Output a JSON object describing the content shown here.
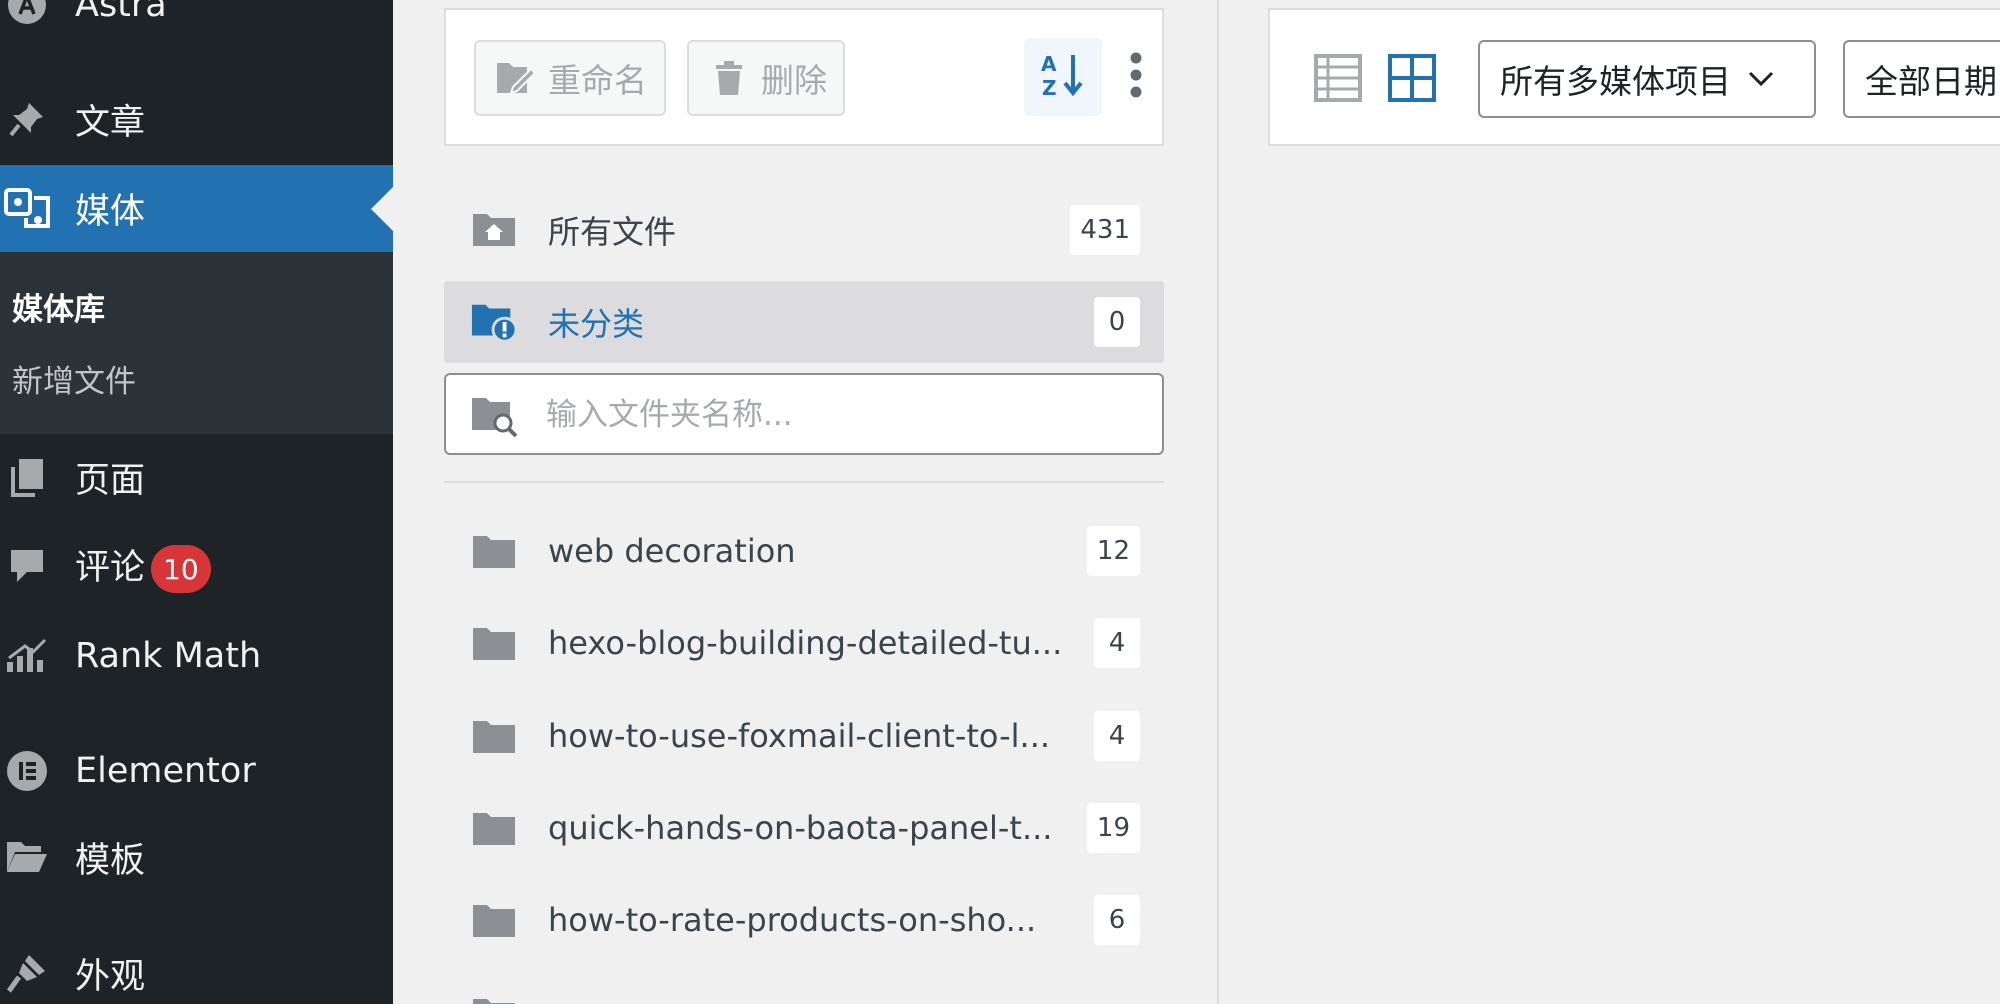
{
  "sidebar": {
    "items": [
      {
        "key": "astra",
        "label": "Astra",
        "icon": "astra-logo-icon"
      },
      {
        "key": "posts",
        "label": "文章",
        "icon": "pin-icon"
      },
      {
        "key": "media",
        "label": "媒体",
        "icon": "media-icon",
        "active": true
      },
      {
        "key": "pages",
        "label": "页面",
        "icon": "pages-icon"
      },
      {
        "key": "comments",
        "label": "评论",
        "icon": "comment-icon",
        "badge": "10"
      },
      {
        "key": "rankmath",
        "label": "Rank Math",
        "icon": "rank-math-icon"
      },
      {
        "key": "elementor",
        "label": "Elementor",
        "icon": "elementor-icon"
      },
      {
        "key": "templates",
        "label": "模板",
        "icon": "folder-open-icon"
      },
      {
        "key": "appearance",
        "label": "外观",
        "icon": "brush-icon"
      }
    ],
    "submenu": [
      {
        "label": "媒体库",
        "current": true
      },
      {
        "label": "新增文件"
      }
    ]
  },
  "folder_panel": {
    "toolbar": {
      "rename_label": "重命名",
      "delete_label": "删除"
    },
    "all_files": {
      "label": "所有文件",
      "count": "431"
    },
    "uncategorized": {
      "label": "未分类",
      "count": "0"
    },
    "search": {
      "placeholder": "输入文件夹名称..."
    },
    "folders": [
      {
        "label": "web decoration",
        "count": "12"
      },
      {
        "label": "hexo-blog-building-detailed-tu...",
        "count": "4"
      },
      {
        "label": "how-to-use-foxmail-client-to-l...",
        "count": "4"
      },
      {
        "label": "quick-hands-on-baota-panel-t...",
        "count": "19"
      },
      {
        "label": "how-to-rate-products-on-sho...",
        "count": "6"
      }
    ]
  },
  "media_toolbar": {
    "type_filter": "所有多媒体项目",
    "date_filter": "全部日期"
  },
  "colors": {
    "sidebar_bg": "#1d2327",
    "accent": "#2271b1",
    "badge": "#d63638"
  }
}
